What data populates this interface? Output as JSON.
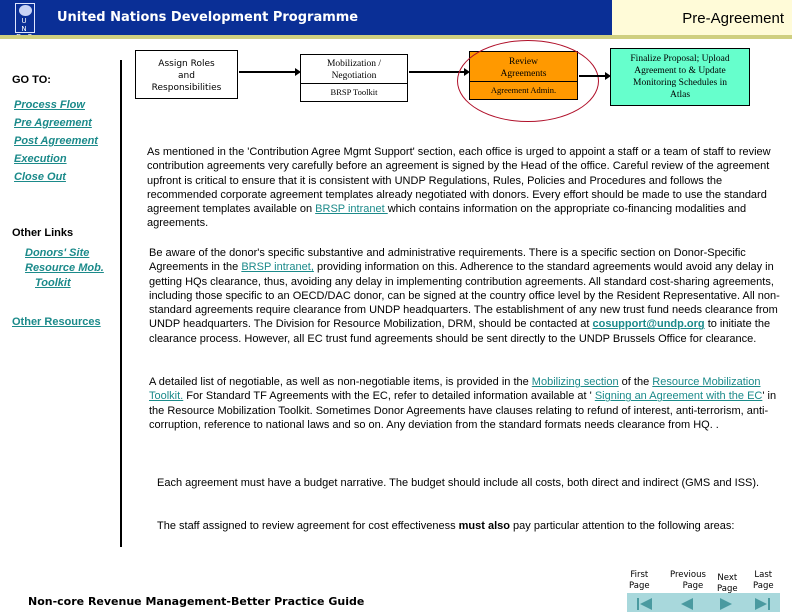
{
  "header": {
    "logo_letters": "U N D P",
    "org_name": "United Nations Development Programme",
    "page_label": "Pre-Agreement"
  },
  "sidebar": {
    "goto_title": "GO TO:",
    "goto_links": [
      "Process Flow",
      "Pre Agreement",
      "Post Agreement",
      "Execution",
      "Close Out"
    ],
    "other_title": "Other Links",
    "other_links": [
      "Donors' Site",
      "Resource Mob.",
      "Toolkit"
    ],
    "other_resources": "Other Resources"
  },
  "flow": {
    "step1": [
      "Assign Roles",
      "and",
      "Responsibilities"
    ],
    "step2_top": [
      "Mobilization /",
      "Negotiation"
    ],
    "step2_bottom": "BRSP Toolkit",
    "step3_top": [
      "Review",
      "Agreements"
    ],
    "step3_bottom": "Agreement Admin.",
    "step4": [
      "Finalize Proposal; Upload",
      "Agreement to & Update",
      "Monitoring Schedules in",
      "Atlas"
    ],
    "colors": {
      "review": "#ff9900",
      "finalize": "#66ffcc",
      "highlight_ellipse": "#b0102a"
    }
  },
  "content": {
    "p1_a": "As mentioned in the 'Contribution Agree Mgmt Support' section, each office is urged to appoint a staff or a team of staff to review contribution agreements very carefully before an agreement is signed by the Head of the office.  Careful review of the agreement upfront is critical to ensure that it is consistent with UNDP Regulations, Rules, Policies and Procedures and follows the recommended corporate agreement templates already negotiated with donors. Every effort should be made to use the standard agreement templates available on ",
    "p1_link": "BRSP intranet ",
    "p1_b": "which contains information on the appropriate co-financing modalities and agreements.",
    "p2_a": "Be aware of the donor's specific substantive and administrative requirements. There is a specific section on Donor-Specific Agreements in the ",
    "p2_link": "BRSP intranet,",
    "p2_b": " providing information on this.   Adherence to the standard agreements would avoid any delay in getting HQs clearance, thus, avoiding any delay in implementing contribution agreements. All standard cost-sharing agreements, including those specific to an OECD/DAC donor, can be signed at the country office level by the Resident Representative. All non-standard agreements require clearance from UNDP headquarters. The establishment of any new trust fund needs clearance from UNDP headquarters. The Division for Resource Mobilization, DRM, should be contacted at ",
    "p2_email": "cosupport@undp.org",
    "p2_c": " to initiate the clearance process. However, all EC trust fund agreements should be sent directly to the UNDP Brussels Office for clearance.",
    "p3_a": "A detailed list of negotiable, as well as non-negotiable items, is provided in the ",
    "p3_link1": "Mobilizing section",
    "p3_b": " of the ",
    "p3_link2": "Resource Mobilization Toolkit.",
    "p3_c": "  For Standard TF Agreements with the EC, refer to detailed information available at ' ",
    "p3_link3": "Signing an Agreement with the EC",
    "p3_d": "' in the Resource Mobilization Toolkit.  Sometimes Donor Agreements have clauses relating to refund of interest, anti-terrorism, anti-corruption, reference to national laws and so on. Any deviation from the standard formats needs clearance from HQ. .",
    "p4": "Each agreement must have a budget narrative.  The budget should include all costs, both direct and indirect (GMS and ISS).",
    "p5_a": "The staff assigned to review agreement for cost effectiveness ",
    "p5_bold": "must also",
    "p5_b": " pay particular attention to the following areas:"
  },
  "footer": {
    "title": "Non-core Revenue Management-Better Practice Guide",
    "nav": [
      {
        "label1": "First",
        "label2": "Page",
        "icon": "first-page-icon"
      },
      {
        "label1": "Previous",
        "label2": "Page",
        "icon": "previous-page-icon"
      },
      {
        "label1": "Next",
        "label2": "Page",
        "icon": "next-page-icon"
      },
      {
        "label1": "Last",
        "label2": "Page",
        "icon": "last-page-icon"
      }
    ]
  }
}
